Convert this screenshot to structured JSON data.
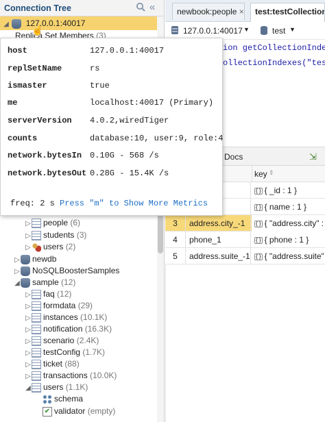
{
  "tree": {
    "title": "Connection Tree",
    "root": {
      "label": "127.0.0.1:40017"
    },
    "replica": {
      "label": "Replica Set Members",
      "count": "(3)"
    },
    "items": [
      {
        "label": "people",
        "count": "(6)"
      },
      {
        "label": "students",
        "count": "(3)"
      },
      {
        "label": "users",
        "count": "(2)"
      },
      {
        "label": "newdb",
        "count": ""
      },
      {
        "label": "NoSQLBoosterSamples",
        "count": ""
      },
      {
        "label": "sample",
        "count": "(12)"
      },
      {
        "label": "faq",
        "count": "(12)"
      },
      {
        "label": "formdata",
        "count": "(29)"
      },
      {
        "label": "instances",
        "count": "(10.1K)"
      },
      {
        "label": "notification",
        "count": "(16.3K)"
      },
      {
        "label": "scenario",
        "count": "(2.4K)"
      },
      {
        "label": "testConfig",
        "count": "(1.7K)"
      },
      {
        "label": "ticket",
        "count": "(88)"
      },
      {
        "label": "transactions",
        "count": "(10.0K)"
      },
      {
        "label": "users",
        "count": "(1.1K)"
      },
      {
        "label": "schema",
        "count": ""
      },
      {
        "label": "validator",
        "count": "(empty)"
      }
    ]
  },
  "tabs": [
    {
      "label": "newbook:people",
      "close": "×"
    },
    {
      "label": "test:testCollection",
      "close": ""
    }
  ],
  "connection": {
    "server": "127.0.0.1:40017",
    "db": "test"
  },
  "code": {
    "line1": "ion getCollectionIndex",
    "line2": "ollectionIndexes(\"test"
  },
  "grid": {
    "title": "Docs",
    "col_key": "key",
    "rows": [
      {
        "n": "",
        "name": "",
        "key": "{ _id : 1 }"
      },
      {
        "n": "",
        "name": "",
        "key": "{ name : 1 }"
      },
      {
        "n": "3",
        "name": "address.city_-1",
        "key": "{ \"address.city\" :"
      },
      {
        "n": "4",
        "name": "phone_1",
        "key": "{ phone : 1 }"
      },
      {
        "n": "5",
        "name": "address.suite_-1",
        "key": "{ \"address.suite\""
      }
    ]
  },
  "popup": {
    "rows": [
      {
        "k": "host",
        "v": "127.0.0.1:40017"
      },
      {
        "k": "replSetName",
        "v": "rs"
      },
      {
        "k": "ismaster",
        "v": "true"
      },
      {
        "k": "me",
        "v": "localhost:40017 (Primary)"
      },
      {
        "k": "serverVersion",
        "v": "4.0.2,wiredTiger"
      },
      {
        "k": "counts",
        "v": "database:10, user:9, role:4"
      },
      {
        "k": "network.bytesIn",
        "v": "0.10G - 568 /s"
      },
      {
        "k": "network.bytesOut",
        "v": "0.28G - 15.4K /s"
      }
    ],
    "freq": "freq: 2 s",
    "hint": "Press \"m\" to Show More Metrics"
  },
  "colors": {
    "selection": "#f6d36f",
    "link": "#1f6fc5"
  }
}
